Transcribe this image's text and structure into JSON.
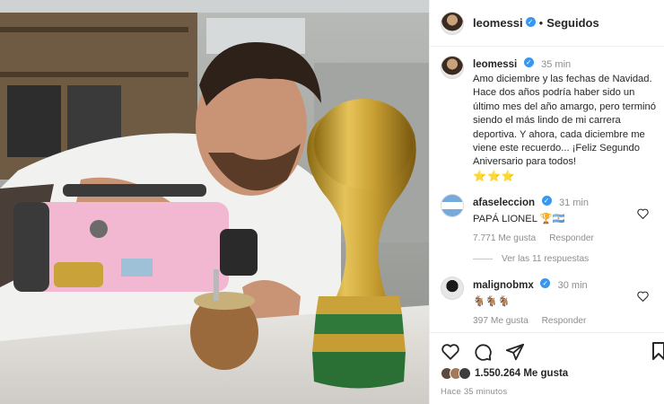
{
  "header": {
    "username": "leomessi",
    "follow_state": "Seguidos",
    "separator": "•"
  },
  "caption": {
    "username": "leomessi",
    "time": "35 min",
    "text": "Amo diciembre y las fechas de Navidad. Hace dos años podría haber sido un último mes del año amargo, pero terminó siendo el más lindo de mi carrera deportiva. Y ahora, cada diciembre me viene este recuerdo... ¡Feliz Segundo Aniversario para todos!",
    "emoji": "⭐⭐⭐"
  },
  "comments": [
    {
      "username": "afaseleccion",
      "time": "31 min",
      "text": "PAPÁ LIONEL 🏆🇦🇷",
      "likes": "7.771 Me gusta",
      "reply_label": "Responder"
    },
    {
      "username": "malignobmx",
      "time": "30 min",
      "text": "🐐🐐🐐",
      "likes": "397 Me gusta",
      "reply_label": "Responder"
    }
  ],
  "view_replies": "Ver las 11 respuestas",
  "post": {
    "likes": "1.550.264 Me gusta",
    "posted_ago": "Hace 35 minutos"
  },
  "icons": {
    "verified": "verified-badge-icon",
    "like": "heart-icon",
    "comment": "comment-bubble-icon",
    "share": "paper-plane-icon",
    "save": "bookmark-icon"
  },
  "colors": {
    "verified_blue": "#3897f0",
    "secondary_text": "#8e8e8e",
    "border": "#efefef"
  }
}
